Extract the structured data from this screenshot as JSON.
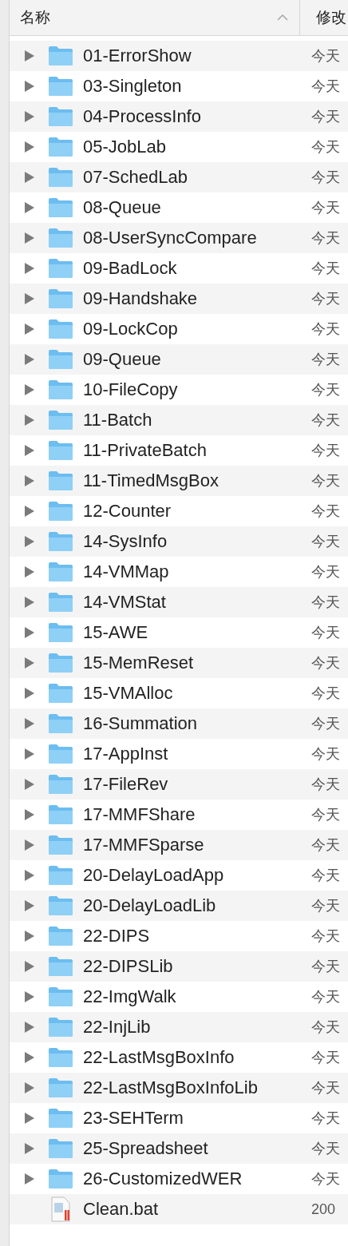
{
  "header": {
    "columns": [
      {
        "label": "名称",
        "sorted": true
      },
      {
        "label": "修改"
      }
    ]
  },
  "rows": [
    {
      "kind": "folder",
      "name": "01-ErrorShow",
      "modified": "今天",
      "expanded": false
    },
    {
      "kind": "folder",
      "name": "03-Singleton",
      "modified": "今天",
      "expanded": false
    },
    {
      "kind": "folder",
      "name": "04-ProcessInfo",
      "modified": "今天",
      "expanded": false
    },
    {
      "kind": "folder",
      "name": "05-JobLab",
      "modified": "今天",
      "expanded": false
    },
    {
      "kind": "folder",
      "name": "07-SchedLab",
      "modified": "今天",
      "expanded": false
    },
    {
      "kind": "folder",
      "name": "08-Queue",
      "modified": "今天",
      "expanded": false
    },
    {
      "kind": "folder",
      "name": "08-UserSyncCompare",
      "modified": "今天",
      "expanded": false
    },
    {
      "kind": "folder",
      "name": "09-BadLock",
      "modified": "今天",
      "expanded": false
    },
    {
      "kind": "folder",
      "name": "09-Handshake",
      "modified": "今天",
      "expanded": false
    },
    {
      "kind": "folder",
      "name": "09-LockCop",
      "modified": "今天",
      "expanded": false
    },
    {
      "kind": "folder",
      "name": "09-Queue",
      "modified": "今天",
      "expanded": false
    },
    {
      "kind": "folder",
      "name": "10-FileCopy",
      "modified": "今天",
      "expanded": false
    },
    {
      "kind": "folder",
      "name": "11-Batch",
      "modified": "今天",
      "expanded": false
    },
    {
      "kind": "folder",
      "name": "11-PrivateBatch",
      "modified": "今天",
      "expanded": false
    },
    {
      "kind": "folder",
      "name": "11-TimedMsgBox",
      "modified": "今天",
      "expanded": false
    },
    {
      "kind": "folder",
      "name": "12-Counter",
      "modified": "今天",
      "expanded": false
    },
    {
      "kind": "folder",
      "name": "14-SysInfo",
      "modified": "今天",
      "expanded": false
    },
    {
      "kind": "folder",
      "name": "14-VMMap",
      "modified": "今天",
      "expanded": false
    },
    {
      "kind": "folder",
      "name": "14-VMStat",
      "modified": "今天",
      "expanded": false
    },
    {
      "kind": "folder",
      "name": "15-AWE",
      "modified": "今天",
      "expanded": false
    },
    {
      "kind": "folder",
      "name": "15-MemReset",
      "modified": "今天",
      "expanded": false
    },
    {
      "kind": "folder",
      "name": "15-VMAlloc",
      "modified": "今天",
      "expanded": false
    },
    {
      "kind": "folder",
      "name": "16-Summation",
      "modified": "今天",
      "expanded": false
    },
    {
      "kind": "folder",
      "name": "17-AppInst",
      "modified": "今天",
      "expanded": false
    },
    {
      "kind": "folder",
      "name": "17-FileRev",
      "modified": "今天",
      "expanded": false
    },
    {
      "kind": "folder",
      "name": "17-MMFShare",
      "modified": "今天",
      "expanded": false
    },
    {
      "kind": "folder",
      "name": "17-MMFSparse",
      "modified": "今天",
      "expanded": false
    },
    {
      "kind": "folder",
      "name": "20-DelayLoadApp",
      "modified": "今天",
      "expanded": false
    },
    {
      "kind": "folder",
      "name": "20-DelayLoadLib",
      "modified": "今天",
      "expanded": false
    },
    {
      "kind": "folder",
      "name": "22-DIPS",
      "modified": "今天",
      "expanded": false
    },
    {
      "kind": "folder",
      "name": "22-DIPSLib",
      "modified": "今天",
      "expanded": false
    },
    {
      "kind": "folder",
      "name": "22-ImgWalk",
      "modified": "今天",
      "expanded": false
    },
    {
      "kind": "folder",
      "name": "22-InjLib",
      "modified": "今天",
      "expanded": false
    },
    {
      "kind": "folder",
      "name": "22-LastMsgBoxInfo",
      "modified": "今天",
      "expanded": false
    },
    {
      "kind": "folder",
      "name": "22-LastMsgBoxInfoLib",
      "modified": "今天",
      "expanded": false
    },
    {
      "kind": "folder",
      "name": "23-SEHTerm",
      "modified": "今天",
      "expanded": false
    },
    {
      "kind": "folder",
      "name": "25-Spreadsheet",
      "modified": "今天",
      "expanded": false
    },
    {
      "kind": "folder",
      "name": "26-CustomizedWER",
      "modified": "今天",
      "expanded": false
    },
    {
      "kind": "file",
      "name": "Clean.bat",
      "modified": "200"
    }
  ]
}
